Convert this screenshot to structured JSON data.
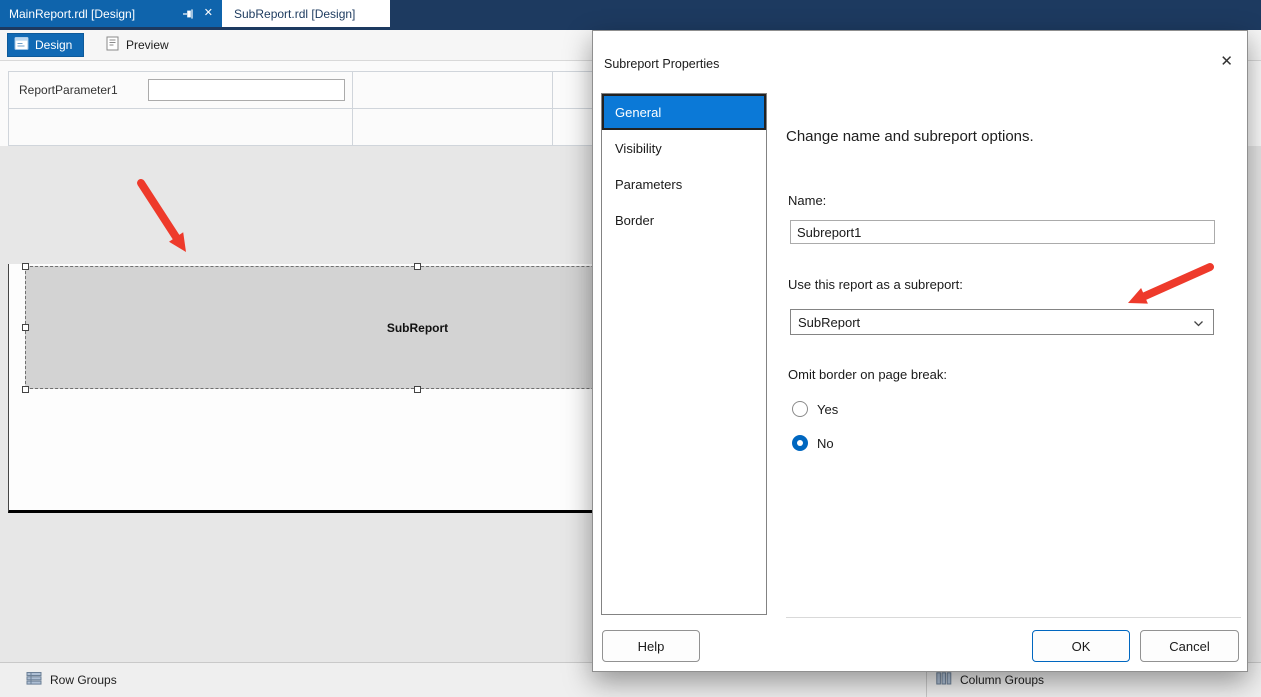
{
  "window": {
    "tabs": [
      {
        "label": "MainReport.rdl [Design]",
        "state": "active"
      },
      {
        "label": "SubReport.rdl [Design]",
        "state": "inactive"
      }
    ],
    "tab_close_glyph": "✕"
  },
  "toolbar": {
    "design_label": "Design",
    "preview_label": "Preview"
  },
  "design_surface": {
    "parameter_name": "ReportParameter1",
    "parameter_value": "",
    "subreport_label": "SubReport"
  },
  "grouping_pane": {
    "row_groups_label": "Row Groups",
    "column_groups_label": "Column Groups"
  },
  "dialog": {
    "title": "Subreport Properties",
    "close_glyph": "✕",
    "nav_items": [
      "General",
      "Visibility",
      "Parameters",
      "Border"
    ],
    "selected_nav": "General",
    "description": "Change name and subreport options.",
    "fields": {
      "name_label": "Name:",
      "name_value": "Subreport1",
      "use_report_label": "Use this report as a subreport:",
      "use_report_value": "SubReport",
      "omit_border_label": "Omit border on page break:",
      "option_yes": "Yes",
      "option_no": "No",
      "selected_option": "No"
    },
    "buttons": {
      "help": "Help",
      "ok": "OK",
      "cancel": "Cancel"
    }
  },
  "icons": {
    "pin": "pushpin",
    "close": "✕",
    "design": "design-surface-document",
    "preview": "report-preview-document",
    "row_groups": "rows-list",
    "column_groups": "columns-grid",
    "combo_chevron": "chevron-down"
  },
  "colors": {
    "active_tab_blue": "#0f64ac",
    "tab_strip_navy": "#1d3a60",
    "nav_selection_blue": "#0b79d7",
    "accent_blue": "#0067c0",
    "arrow_red": "#ee3a2b",
    "subreport_gray": "#d3d3d3"
  }
}
